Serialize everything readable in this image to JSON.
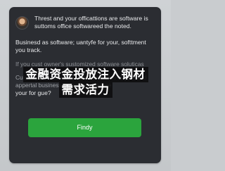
{
  "chat_panel": {
    "intro_message": "Threst and your officattions are software is suttoms office softwareed the noted.",
    "body_message": "Businesd as software; uantyfe for your, softtment you track.",
    "faded_message": "If you cust owner's sustomized software soluticas",
    "caption_message": "Cuick by software sandwittes with sreoving thaked appertal business software rsaftware",
    "question": "your for gue?",
    "primary_button_label": "Findy"
  },
  "overlay": {
    "line_1": "金融资金投放注入钢材",
    "line_2": "需求活力"
  },
  "colors": {
    "panel_background": "#2b2d32",
    "button_green": "#2ba43d",
    "overlay_background": "#0c0c0e"
  }
}
